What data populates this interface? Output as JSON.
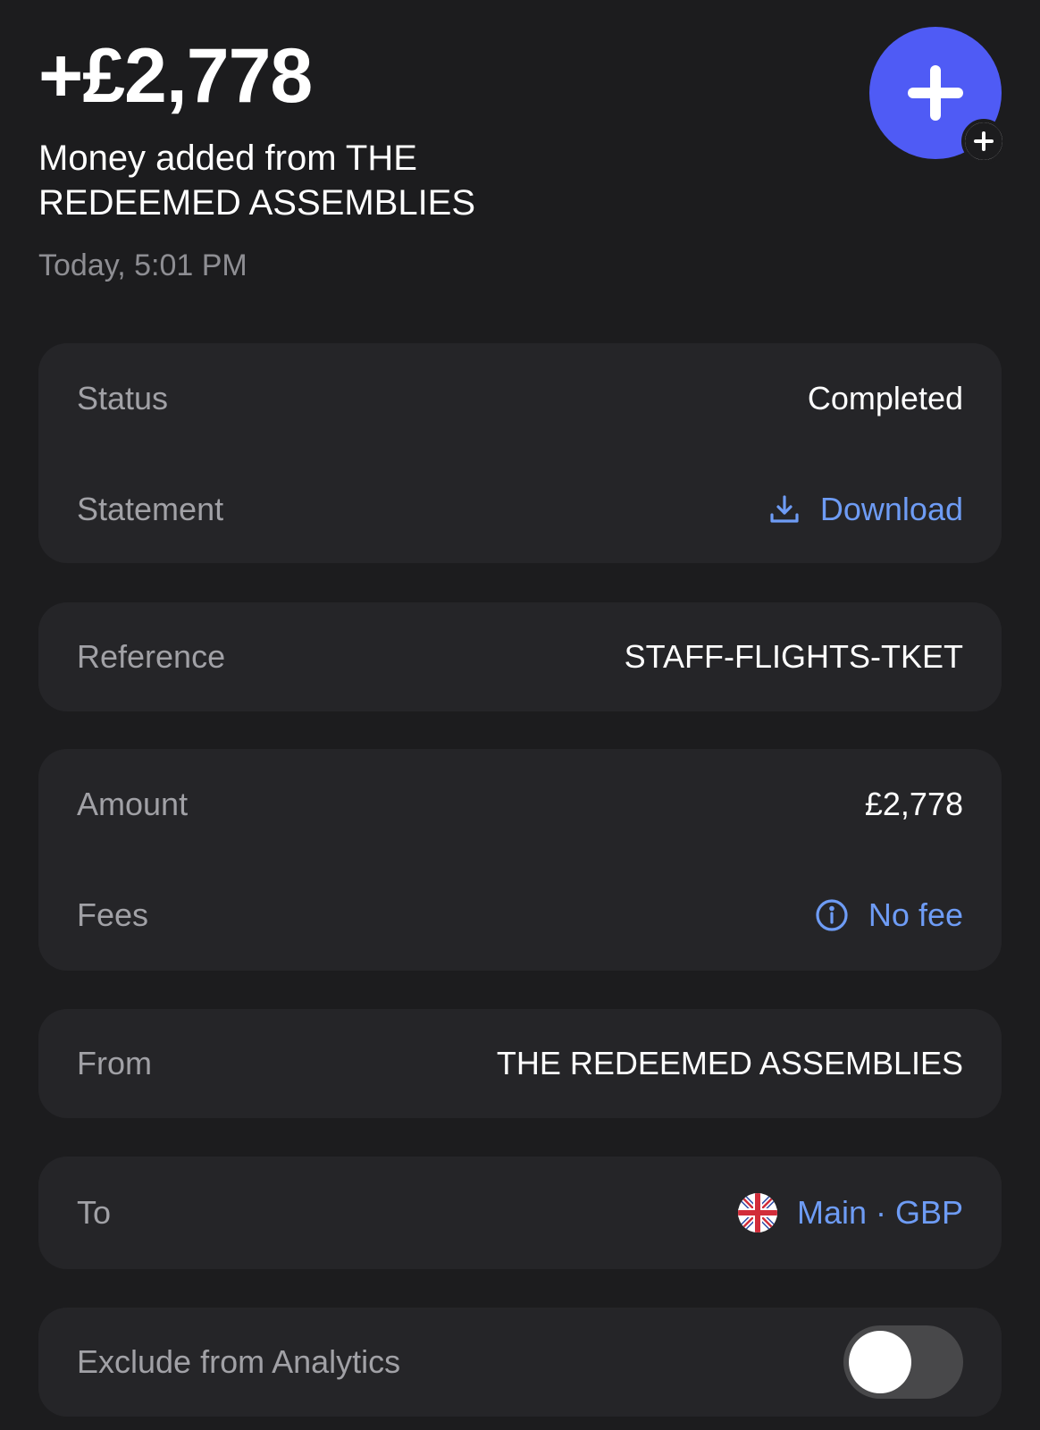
{
  "header": {
    "amount": "+£2,778",
    "title": "Money added from THE REDEEMED ASSEMBLIES",
    "timestamp": "Today, 5:01 PM",
    "avatar_icon": "plus-icon",
    "avatar_color": "#4f5bf5",
    "badge_icon": "plus-circle-icon"
  },
  "details": {
    "status": {
      "label": "Status",
      "value": "Completed"
    },
    "statement": {
      "label": "Statement",
      "value": "Download",
      "icon": "download-icon"
    },
    "reference": {
      "label": "Reference",
      "value": "STAFF-FLIGHTS-TKET"
    },
    "amount": {
      "label": "Amount",
      "value": "£2,778"
    },
    "fees": {
      "label": "Fees",
      "value": "No fee",
      "icon": "info-icon"
    },
    "from": {
      "label": "From",
      "value": "THE REDEEMED ASSEMBLIES"
    },
    "to": {
      "label": "To",
      "value": "Main · GBP",
      "icon": "uk-flag-icon"
    },
    "analytics": {
      "label": "Exclude from Analytics",
      "enabled": false
    }
  },
  "colors": {
    "background": "#1c1c1e",
    "card": "#252528",
    "link": "#6e9cf5",
    "label": "#a1a1a6"
  }
}
